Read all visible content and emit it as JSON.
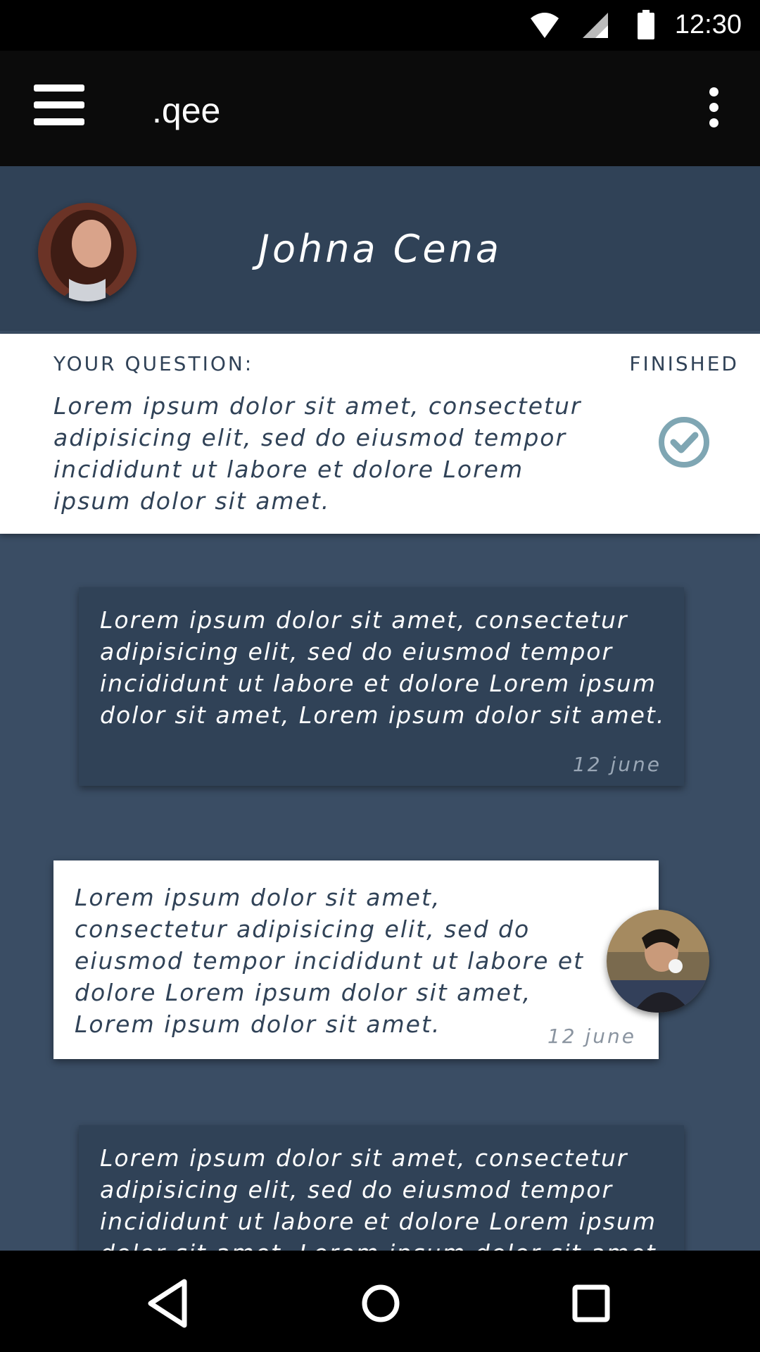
{
  "status_bar": {
    "time": "12:30",
    "icons": [
      "wifi-icon",
      "signal-icon",
      "battery-icon"
    ]
  },
  "toolbar": {
    "title": ".qee",
    "menu_icon": "hamburger-menu-icon",
    "overflow_icon": "more-vertical-icon"
  },
  "profile": {
    "name": "Johna Cena"
  },
  "question": {
    "label": "YOUR QUESTION:",
    "status": "FINISHED",
    "text": "Lorem ipsum dolor sit amet, consectetur adipisicing elit, sed do eiusmod tempor incididunt ut labore et dolore Lorem ipsum dolor sit amet.",
    "status_icon": "check-circle-icon"
  },
  "messages": [
    {
      "text": "Lorem ipsum dolor sit amet, consectetur adipisicing elit, sed do eiusmod tempor incididunt ut labore et dolore Lorem ipsum dolor sit amet, Lorem ipsum dolor sit amet.",
      "date": "12 june"
    },
    {
      "text": "Lorem ipsum dolor sit amet, consectetur adipisicing elit, sed do eiusmod tempor incididunt ut labore et dolore Lorem ipsum dolor sit amet, Lorem ipsum dolor sit amet.",
      "date": "12 june"
    },
    {
      "text": "Lorem ipsum dolor sit amet, consectetur adipisicing elit, sed do eiusmod tempor incididunt ut labore et dolore Lorem ipsum dolor sit amet, Lorem ipsum dolor sit amet.",
      "date": ""
    }
  ],
  "nav_bar": {
    "icons": [
      "back-icon",
      "home-icon",
      "recents-icon"
    ]
  },
  "colors": {
    "background": "#3a4d64",
    "header": "#304257",
    "toolbar": "#0b0b0b",
    "accent_check": "#7fa6b3"
  }
}
